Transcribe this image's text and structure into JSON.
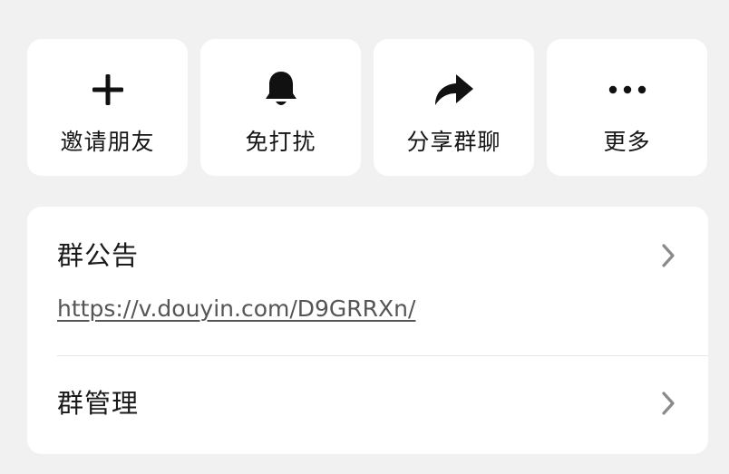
{
  "actions": [
    {
      "label": "邀请朋友",
      "icon": "plus-icon"
    },
    {
      "label": "免打扰",
      "icon": "bell-icon"
    },
    {
      "label": "分享群聊",
      "icon": "share-arrow-icon"
    },
    {
      "label": "更多",
      "icon": "more-dots-icon"
    }
  ],
  "announcement": {
    "title": "群公告",
    "link": "https://v.douyin.com/D9GRRXn/"
  },
  "management": {
    "title": "群管理"
  },
  "colors": {
    "background": "#f1f1f1",
    "card": "#ffffff",
    "icon": "#111111",
    "link": "#555555",
    "chevron": "#8a8a8a"
  }
}
